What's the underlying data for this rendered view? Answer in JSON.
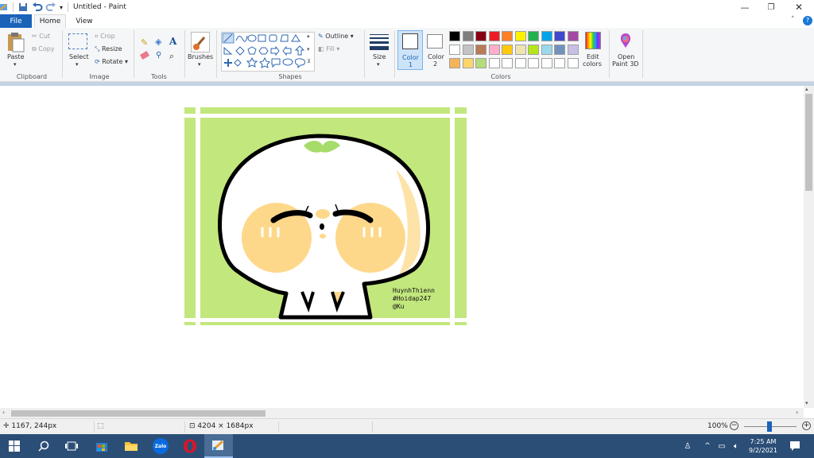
{
  "window": {
    "title": "Untitled - Paint"
  },
  "tabs": [
    {
      "label": "File"
    },
    {
      "label": "Home"
    },
    {
      "label": "View"
    }
  ],
  "ribbon": {
    "clipboard": {
      "paste": "Paste",
      "cut": "Cut",
      "copy": "Copy",
      "label": "Clipboard"
    },
    "image": {
      "select": "Select",
      "crop": "Crop",
      "resize": "Resize",
      "rotate": "Rotate",
      "label": "Image"
    },
    "tools": {
      "label": "Tools"
    },
    "brushes": {
      "label": "Brushes"
    },
    "shapes": {
      "outline": "Outline",
      "fill": "Fill",
      "label": "Shapes"
    },
    "size": {
      "label": "Size"
    },
    "color1": {
      "label": "Color",
      "num": "1"
    },
    "color2": {
      "label": "Color",
      "num": "2"
    },
    "colors": {
      "label": "Colors",
      "row1": [
        "#000000",
        "#7f7f7f",
        "#880015",
        "#ed1c24",
        "#ff7f27",
        "#fff200",
        "#22b14c",
        "#00a2e8",
        "#3f48cc",
        "#a349a4"
      ],
      "row2": [
        "#ffffff",
        "#c3c3c3",
        "#b97a57",
        "#ffaec9",
        "#ffc90e",
        "#efe4b0",
        "#b5e61d",
        "#99d9ea",
        "#7092be",
        "#c8bfe7"
      ],
      "row3": [
        "#f7b35a",
        "#fdd56a",
        "#b4dd7a",
        "#ffffff",
        "#ffffff",
        "#ffffff",
        "#ffffff",
        "#ffffff",
        "#ffffff",
        "#ffffff"
      ]
    },
    "edit_colors": {
      "line1": "Edit",
      "line2": "colors"
    },
    "paint3d": {
      "line1": "Open",
      "line2": "Paint 3D"
    }
  },
  "canvas": {
    "bg_color": "#c2e77d",
    "signature": {
      "line1": "HuynhThienn",
      "line2": "#Hoidap247",
      "line3": "@Ku"
    }
  },
  "status": {
    "cursor": "1167, 244px",
    "size": "4204 × 1684px",
    "zoom": "100%"
  },
  "taskbar": {
    "time": "7:25 AM",
    "date": "9/2/2021",
    "zalo": "Zalo"
  }
}
